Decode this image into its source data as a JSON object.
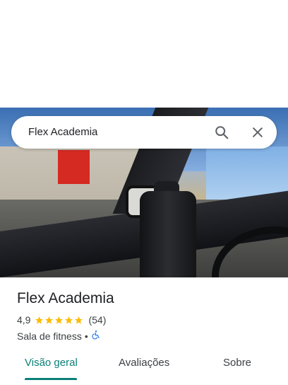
{
  "search": {
    "query": "Flex Academia"
  },
  "photo": {
    "description_icon": "place-photo"
  },
  "place": {
    "name": "Flex Academia",
    "rating": "4,9",
    "star_count": 5,
    "review_count": "(54)",
    "category": "Sala de fitness",
    "separator": "•"
  },
  "tabs": [
    {
      "label": "Visão geral",
      "active": true
    },
    {
      "label": "Avaliações",
      "active": false
    },
    {
      "label": "Sobre",
      "active": false
    }
  ],
  "colors": {
    "accent": "#0b8078",
    "star": "#fbbc04",
    "accessibility": "#1a73e8"
  }
}
